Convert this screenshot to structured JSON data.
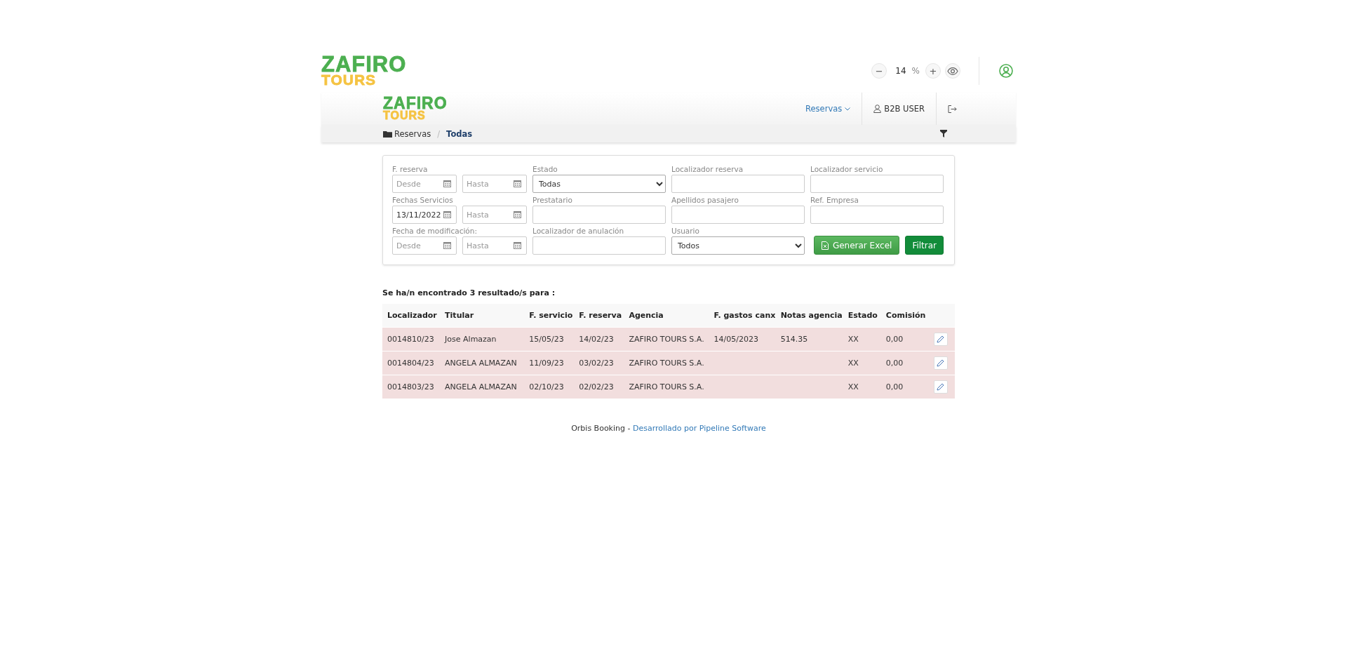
{
  "brand": {
    "line1": "ZAFIRO",
    "line2": "TOURS"
  },
  "zoom": {
    "decrease": "−",
    "value": "14",
    "unit": "%",
    "increase": "+"
  },
  "navbar": {
    "brand": {
      "line1": "ZAFIRO",
      "line2": "TOURS"
    },
    "menu": [
      {
        "kind": "dropdown",
        "label": "Reservas"
      },
      {
        "kind": "user",
        "label": "B2B USER"
      },
      {
        "kind": "logout"
      }
    ]
  },
  "breadcrumb": [
    {
      "label": "Reservas",
      "current": false
    },
    {
      "label": "Todas",
      "current": true
    }
  ],
  "breadcrumb_separator": "/",
  "filters": {
    "fields": [
      {
        "kind": "date-range",
        "label": "F. reserva",
        "from": {
          "placeholder": "Desde"
        },
        "to": {
          "placeholder": "Hasta"
        }
      },
      {
        "kind": "select",
        "label": "Estado",
        "value": "Todas"
      },
      {
        "kind": "text",
        "label": "Localizador reserva"
      },
      {
        "kind": "text",
        "label": "Localizador servicio"
      },
      {
        "kind": "date-range",
        "label": "Fechas Servicios",
        "from": {
          "value": "13/11/2022"
        },
        "to": {
          "placeholder": "Hasta"
        }
      },
      {
        "kind": "text",
        "label": "Prestatario"
      },
      {
        "kind": "text",
        "label": "Apellidos pasajero"
      },
      {
        "kind": "text",
        "label": "Ref. Empresa"
      },
      {
        "kind": "date-range",
        "label": "Fecha de modificación:",
        "from": {
          "placeholder": "Desde"
        },
        "to": {
          "placeholder": "Hasta"
        }
      },
      {
        "kind": "text",
        "label": "Localizador de anulación"
      },
      {
        "kind": "select",
        "label": "Usuario",
        "value": "Todos"
      }
    ],
    "buttons": [
      {
        "kind": "excel",
        "label": "Generar Excel"
      },
      {
        "kind": "primary",
        "label": "Filtrar"
      }
    ]
  },
  "results_summary": "Se ha/n encontrado 3 resultado/s para :",
  "table": {
    "columns": [
      "Localizador",
      "Titular",
      "F. servicio",
      "F. reserva",
      "Agencia",
      "F. gastos canx",
      "Notas agencia",
      "Estado",
      "Comisión"
    ],
    "rows": [
      {
        "cells": [
          "0014810/23",
          "Jose Almazan",
          "15/05/23",
          "14/02/23",
          "ZAFIRO TOURS S.A.",
          "14/05/2023",
          "514.35",
          "XX",
          "0,00"
        ]
      },
      {
        "cells": [
          "0014804/23",
          "ANGELA ALMAZAN",
          "11/09/23",
          "03/02/23",
          "ZAFIRO TOURS S.A.",
          "",
          "",
          "XX",
          "0,00"
        ]
      },
      {
        "cells": [
          "0014803/23",
          "ANGELA ALMAZAN",
          "02/10/23",
          "02/02/23",
          "ZAFIRO TOURS S.A.",
          "",
          "",
          "XX",
          "0,00"
        ]
      }
    ]
  },
  "footer": {
    "text": "Orbis Booking - ",
    "link": "Desarrollado por Pipeline Software"
  }
}
